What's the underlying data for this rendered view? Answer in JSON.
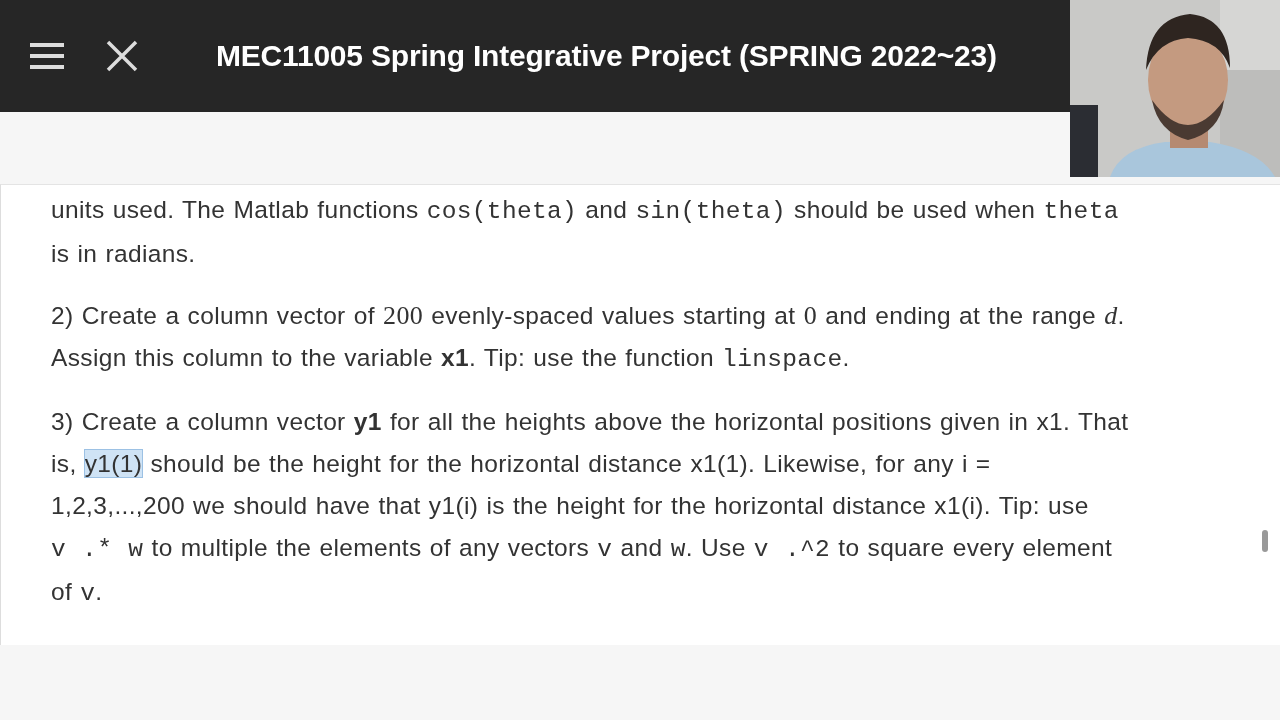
{
  "header": {
    "title": "MEC11005 Spring Integrative Project (SPRING 2022~23)"
  },
  "paragraphs": [
    [
      {
        "kind": "plain",
        "text": "units used. The Matlab functions "
      },
      {
        "kind": "code",
        "text": "cos(theta)"
      },
      {
        "kind": "plain",
        "text": " and "
      },
      {
        "kind": "code",
        "text": "sin(theta)"
      },
      {
        "kind": "plain",
        "text": " should be used when "
      },
      {
        "kind": "code",
        "text": "theta"
      },
      {
        "kind": "plain",
        "text": " is in radians."
      }
    ],
    [
      {
        "kind": "plain",
        "text": "2) Create a column vector of "
      },
      {
        "kind": "math",
        "text": "200"
      },
      {
        "kind": "plain",
        "text": " evenly-spaced values starting at "
      },
      {
        "kind": "math",
        "text": "0"
      },
      {
        "kind": "plain",
        "text": " and ending at the range "
      },
      {
        "kind": "mathit",
        "text": "d"
      },
      {
        "kind": "plain",
        "text": ". Assign this column to the variable "
      },
      {
        "kind": "bold",
        "text": "x1"
      },
      {
        "kind": "plain",
        "text": ". Tip: use the function "
      },
      {
        "kind": "code",
        "text": "linspace"
      },
      {
        "kind": "plain",
        "text": "."
      }
    ],
    [
      {
        "kind": "plain",
        "text": "3) Create a column vector "
      },
      {
        "kind": "bold",
        "text": "y1"
      },
      {
        "kind": "plain",
        "text": " for all the heights above the horizontal positions given in x1. That is, "
      },
      {
        "kind": "highlight",
        "text": "y1(1)"
      },
      {
        "kind": "plain",
        "text": " should be the height for the horizontal distance x1(1). Likewise, for any i = 1,2,3,...,200  we should have that y1(i) is the height for the horizontal distance x1(i). Tip: use "
      },
      {
        "kind": "code",
        "text": "v .* w"
      },
      {
        "kind": "plain",
        "text": " to multiple the elements of any vectors "
      },
      {
        "kind": "code",
        "text": "v"
      },
      {
        "kind": "plain",
        "text": " and "
      },
      {
        "kind": "code",
        "text": "w"
      },
      {
        "kind": "plain",
        "text": ". Use "
      },
      {
        "kind": "code",
        "text": "v .^2"
      },
      {
        "kind": "plain",
        "text": " to square every element of "
      },
      {
        "kind": "code",
        "text": "v"
      },
      {
        "kind": "plain",
        "text": "."
      }
    ]
  ]
}
